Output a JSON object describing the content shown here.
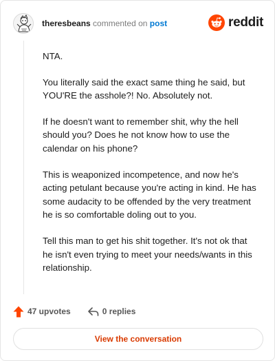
{
  "header": {
    "username": "theresbeans",
    "action_text": "commented on",
    "post_link_label": "post",
    "brand_name": "reddit"
  },
  "comment": {
    "paragraphs": [
      "NTA.",
      "You literally said the exact same thing he said, but YOU'RE the asshole?! No. Absolutely not.",
      "If he doesn't want to remember shit, why the hell should you? Does he not know how to use the calendar on his phone?",
      "This is weaponized incompetence, and now he's acting petulant because you're acting in kind. He has some audacity to be offended by the very treatment he is so comfortable doling out to you.",
      "Tell this man to get his shit together. It's not ok that he isn't even trying to meet your needs/wants in this relationship."
    ]
  },
  "footer": {
    "upvotes_label": "47 upvotes",
    "replies_label": "0 replies",
    "view_button_label": "View the conversation"
  },
  "colors": {
    "brand_orange": "#ff4500",
    "link_blue": "#0079d3",
    "button_text": "#d93a00"
  }
}
